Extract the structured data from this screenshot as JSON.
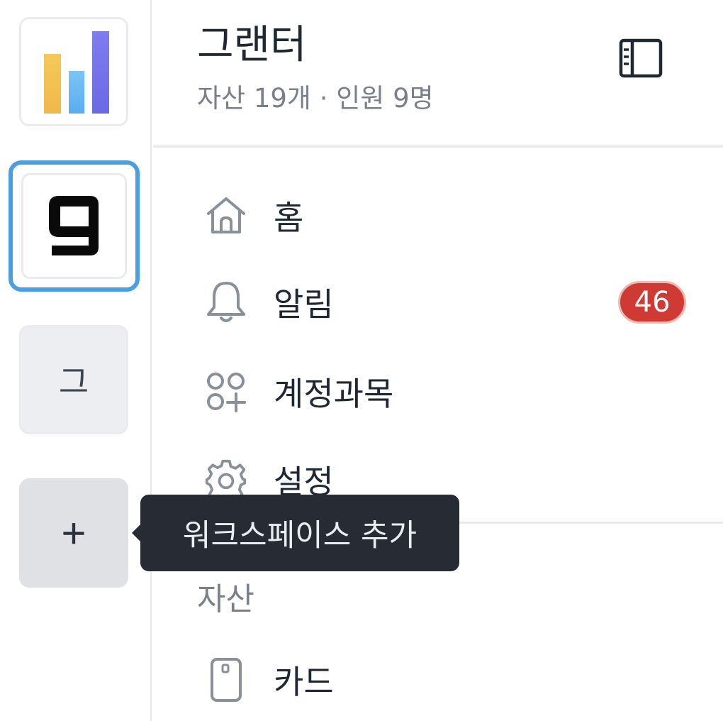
{
  "workspace_rail": {
    "items": [
      {
        "name": "chart-workspace",
        "icon": "bar-chart-logo",
        "selected": false
      },
      {
        "name": "g-workspace",
        "icon": "g-logo",
        "selected": true
      },
      {
        "name": "letter-workspace",
        "letter": "그",
        "selected": false
      }
    ],
    "add_button": {
      "symbol": "+",
      "tooltip": "워크스페이스 추가"
    },
    "selected_color": "#4a9fe3"
  },
  "header": {
    "title": "그랜터",
    "subtitle": "자산 19개 · 인원 9명",
    "collapse_icon": "sidebar-collapse-icon"
  },
  "nav": {
    "items": [
      {
        "label": "홈",
        "icon": "home-icon"
      },
      {
        "label": "알림",
        "icon": "bell-icon",
        "badge": "46"
      },
      {
        "label": "계정과목",
        "icon": "account-categories-icon"
      },
      {
        "label": "설정",
        "icon": "gear-icon"
      }
    ]
  },
  "sections": {
    "assets": {
      "label": "자산",
      "items": [
        {
          "label": "카드",
          "icon": "card-icon"
        }
      ]
    }
  },
  "colors": {
    "badge": "#cf3b34",
    "tooltip_bg": "#262b34"
  }
}
